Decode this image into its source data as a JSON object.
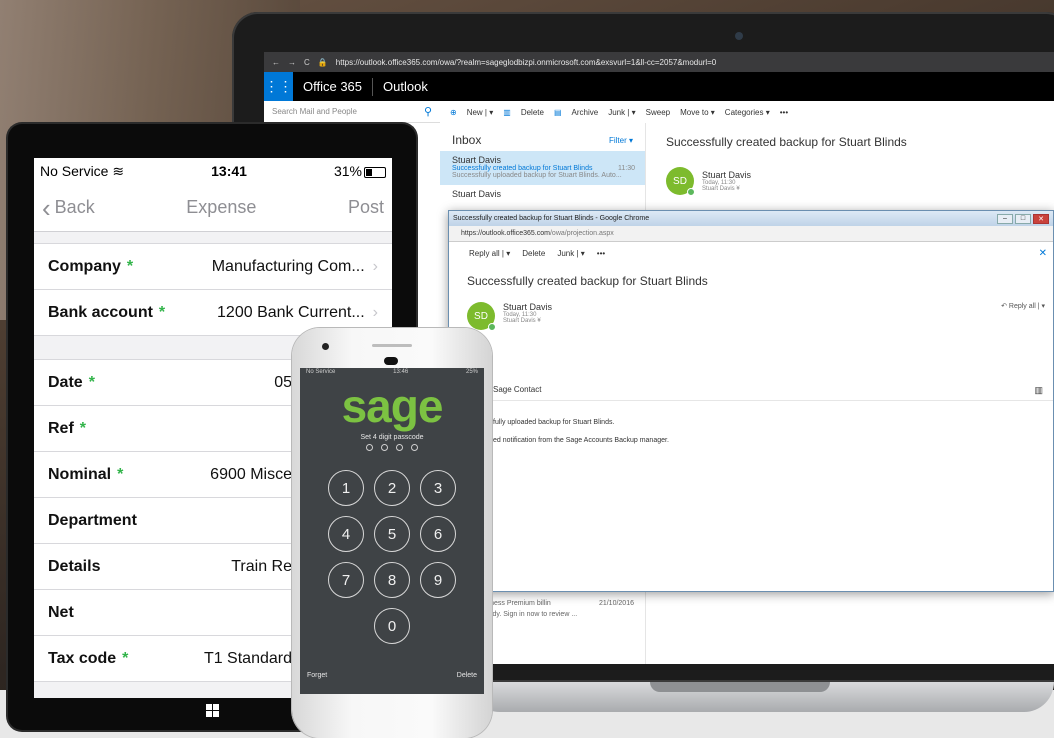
{
  "browser": {
    "url": "https://outlook.office365.com/owa/?realm=sageglodbizpi.onmicrosoft.com&exsvurl=1&ll-cc=2057&modurl=0"
  },
  "o365": {
    "brand": "Office 365",
    "app": "Outlook",
    "search_placeholder": "Search Mail and People",
    "commands": [
      "New | ▾",
      "Delete",
      "Archive",
      "Junk | ▾",
      "Sweep",
      "Move to ▾",
      "Categories ▾",
      "•••"
    ]
  },
  "inbox": {
    "title": "Inbox",
    "filter": "Filter ▾",
    "items": [
      {
        "from": "Stuart Davis",
        "subject": "Successfully created backup for Stuart Blinds",
        "time": "11:30",
        "preview": "Successfully uploaded backup for Stuart Blinds.  Auto..."
      },
      {
        "from": "Stuart Davis",
        "subject": "",
        "time": "",
        "preview": ""
      }
    ],
    "lower_preview": "ice 365 Business Premium billin",
    "lower_date": "21/10/2016",
    "lower_line": "tement is ready. Sign in now to review ...",
    "lower_link": "age"
  },
  "reading": {
    "subject": "Successfully created backup for Stuart Blinds",
    "avatar_initials": "SD",
    "sender": "Stuart Davis",
    "time": "Today, 11:30",
    "to": "Stuart Davis  ¥"
  },
  "popup": {
    "window_title": "Successfully created backup for Stuart Blinds - Google Chrome",
    "url_host": "https://outlook.office365.com",
    "url_path": "/owa/projection.aspx",
    "commands": [
      "Reply all | ▾",
      "Delete",
      "Junk | ▾",
      "•••"
    ],
    "subject": "Successfully created backup for Stuart Blinds",
    "avatar_initials": "SD",
    "sender": "Stuart Davis",
    "time": "Today, 11:30",
    "to": "Stuart Davis  ¥",
    "reply_all": "Reply all",
    "contact": "Sage Contact",
    "body_line_1": "fully uploaded backup for Stuart Blinds.",
    "body_line_2": "ed notification from the Sage Accounts Backup manager."
  },
  "tablet": {
    "status": {
      "carrier": "No Service",
      "time": "13:41",
      "battery": "31%"
    },
    "nav": {
      "back": "Back",
      "title": "Expense",
      "action": "Post"
    },
    "rows": [
      {
        "label": "Company",
        "required": "*",
        "value": "Manufacturing Com...",
        "arrow": "›"
      },
      {
        "label": "Bank account",
        "required": "*",
        "value": "1200 Bank Current...",
        "arrow": "›"
      },
      {
        "label": "Date",
        "required": "*",
        "value": "05",
        "arrow": ""
      },
      {
        "label": "Ref",
        "required": "*",
        "value": "",
        "arrow": ""
      },
      {
        "label": "Nominal",
        "required": "*",
        "value": "6900 Misce",
        "arrow": ""
      },
      {
        "label": "Department",
        "required": "",
        "value": "",
        "arrow": ""
      },
      {
        "label": "Details",
        "required": "",
        "value": "Train Re",
        "arrow": ""
      },
      {
        "label": "Net",
        "required": "",
        "value": "",
        "arrow": ""
      },
      {
        "label": "Tax code",
        "required": "*",
        "value": "T1 Standard",
        "arrow": ""
      }
    ]
  },
  "phone": {
    "status_left": "No Service",
    "status_time": "13:46",
    "status_right": "25%",
    "logo": "sage",
    "prompt": "Set 4 digit passcode",
    "keys": [
      "1",
      "2",
      "3",
      "4",
      "5",
      "6",
      "7",
      "8",
      "9",
      "0"
    ],
    "forget": "Forget",
    "delete": "Delete",
    "logo_color": "#7cc242"
  },
  "colors": {
    "office_blue": "#0078d7",
    "avatar_green": "#7dbb2d",
    "required_green": "#32b44a",
    "phone_bg": "#3f4346"
  }
}
